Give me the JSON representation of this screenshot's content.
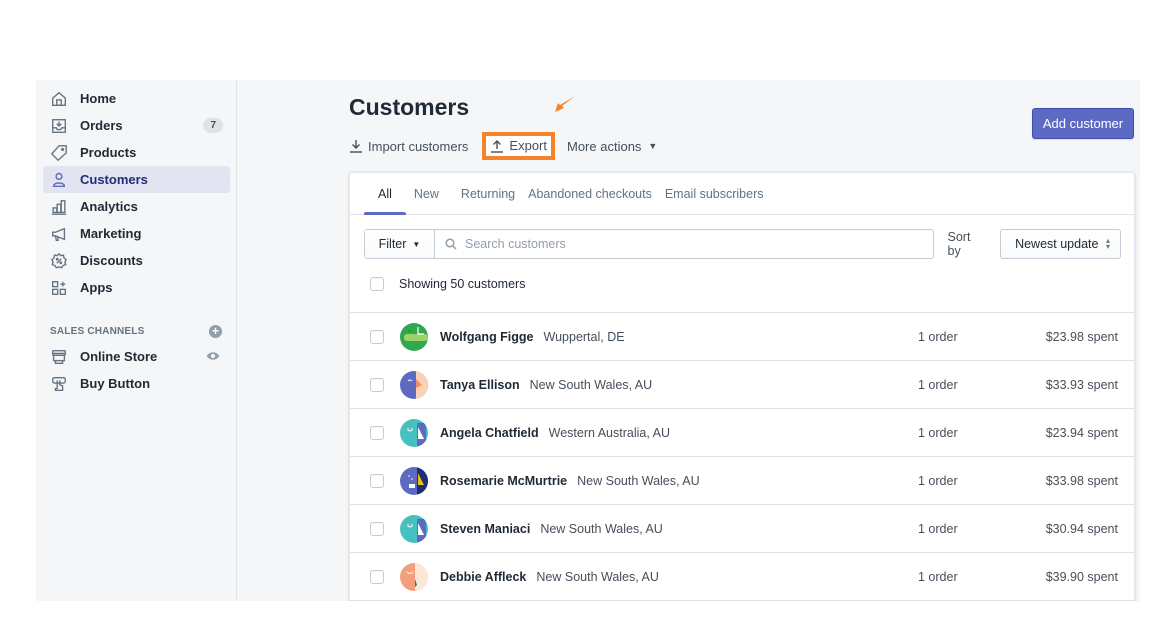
{
  "sidebar": {
    "nav": [
      {
        "label": "Home",
        "icon": "home-icon"
      },
      {
        "label": "Orders",
        "icon": "orders-icon",
        "badge": "7"
      },
      {
        "label": "Products",
        "icon": "tag-icon"
      },
      {
        "label": "Customers",
        "icon": "person-icon",
        "active": true
      },
      {
        "label": "Analytics",
        "icon": "bar-chart-icon"
      },
      {
        "label": "Marketing",
        "icon": "megaphone-icon"
      },
      {
        "label": "Discounts",
        "icon": "discount-icon"
      },
      {
        "label": "Apps",
        "icon": "apps-icon"
      }
    ],
    "sales_channels": {
      "title": "SALES CHANNELS",
      "add_icon": "plus-circle-icon",
      "items": [
        {
          "label": "Online Store",
          "icon": "store-icon",
          "trailing_icon": "eye-icon"
        },
        {
          "label": "Buy Button",
          "icon": "buy-button-icon"
        }
      ]
    }
  },
  "header": {
    "title": "Customers",
    "actions": {
      "import_label": "Import customers",
      "export_label": "Export",
      "more_label": "More actions"
    },
    "add_button_label": "Add customer",
    "highlight_color": "#f5832b"
  },
  "tabs": [
    {
      "label": "All",
      "active": true
    },
    {
      "label": "New"
    },
    {
      "label": "Returning"
    },
    {
      "label": "Abandoned checkouts"
    },
    {
      "label": "Email subscribers"
    }
  ],
  "filters": {
    "filter_label": "Filter",
    "search_placeholder": "Search customers",
    "search_value": "",
    "sort_label": "Sort by",
    "sort_value": "Newest update"
  },
  "list": {
    "showing_text": "Showing 50 customers",
    "customers": [
      {
        "name": "Wolfgang Figge",
        "location": "Wuppertal, DE",
        "orders": "1 order",
        "spent": "$23.98 spent"
      },
      {
        "name": "Tanya Ellison",
        "location": "New South Wales, AU",
        "orders": "1 order",
        "spent": "$33.93 spent"
      },
      {
        "name": "Angela Chatfield",
        "location": "Western Australia, AU",
        "orders": "1 order",
        "spent": "$23.94 spent"
      },
      {
        "name": "Rosemarie McMurtrie",
        "location": "New South Wales, AU",
        "orders": "1 order",
        "spent": "$33.98 spent"
      },
      {
        "name": "Steven Maniaci",
        "location": "New South Wales, AU",
        "orders": "1 order",
        "spent": "$30.94 spent"
      },
      {
        "name": "Debbie Affleck",
        "location": "New South Wales, AU",
        "orders": "1 order",
        "spent": "$39.90 spent"
      }
    ]
  },
  "colors": {
    "accent": "#5c6ac4",
    "active_nav_bg": "#e2e5f1",
    "active_nav_text": "#202e78",
    "background": "#f4f6f8"
  }
}
